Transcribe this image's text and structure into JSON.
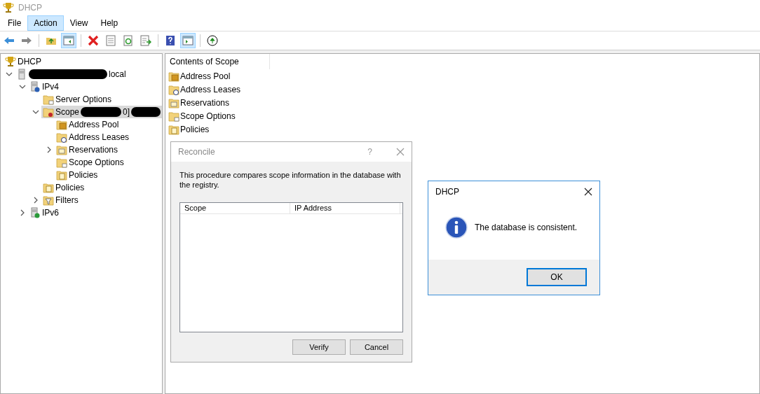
{
  "window": {
    "title": "DHCP"
  },
  "menu": [
    {
      "label": "File",
      "selected": false
    },
    {
      "label": "Action",
      "selected": true
    },
    {
      "label": "View",
      "selected": false
    },
    {
      "label": "Help",
      "selected": false
    }
  ],
  "toolbar": [
    {
      "kind": "back",
      "pressed": false
    },
    {
      "kind": "forward",
      "pressed": false
    },
    {
      "kind": "separator"
    },
    {
      "kind": "up-folder",
      "pressed": false
    },
    {
      "kind": "console-tree",
      "pressed": true
    },
    {
      "kind": "separator"
    },
    {
      "kind": "delete",
      "pressed": false
    },
    {
      "kind": "properties",
      "pressed": false
    },
    {
      "kind": "refresh",
      "pressed": false
    },
    {
      "kind": "export",
      "pressed": false
    },
    {
      "kind": "separator"
    },
    {
      "kind": "help",
      "pressed": false
    },
    {
      "kind": "action-pane",
      "pressed": true
    },
    {
      "kind": "separator"
    },
    {
      "kind": "start",
      "pressed": false
    }
  ],
  "tree": [
    {
      "kind": "dhcp",
      "selected": false,
      "parts": [
        {
          "kind": "text",
          "text": "DHCP"
        }
      ],
      "children": [
        {
          "kind": "server",
          "expanded": true,
          "selected": false,
          "parts": [
            {
              "kind": "redaction"
            },
            {
              "kind": "text",
              "text": "local"
            }
          ],
          "children": [
            {
              "kind": "ipv4",
              "expanded": true,
              "selected": false,
              "parts": [
                {
                  "kind": "text",
                  "text": "IPv4"
                }
              ],
              "children": [
                {
                  "kind": "options",
                  "selected": false,
                  "parts": [
                    {
                      "kind": "text",
                      "text": "Server Options"
                    }
                  ]
                },
                {
                  "kind": "scope",
                  "expanded": true,
                  "selected": true,
                  "parts": [
                    {
                      "kind": "text",
                      "text": "Scope"
                    },
                    {
                      "kind": "redaction"
                    },
                    {
                      "kind": "text",
                      "text": "0]"
                    },
                    {
                      "kind": "redaction"
                    }
                  ],
                  "children": [
                    {
                      "kind": "pool",
                      "selected": false,
                      "parts": [
                        {
                          "kind": "text",
                          "text": "Address Pool"
                        }
                      ]
                    },
                    {
                      "kind": "leases",
                      "selected": false,
                      "parts": [
                        {
                          "kind": "text",
                          "text": "Address Leases"
                        }
                      ]
                    },
                    {
                      "kind": "reservations",
                      "expanded": false,
                      "selected": false,
                      "parts": [
                        {
                          "kind": "text",
                          "text": "Reservations"
                        }
                      ]
                    },
                    {
                      "kind": "options",
                      "selected": false,
                      "parts": [
                        {
                          "kind": "text",
                          "text": "Scope Options"
                        }
                      ]
                    },
                    {
                      "kind": "policies",
                      "selected": false,
                      "parts": [
                        {
                          "kind": "text",
                          "text": "Policies"
                        }
                      ]
                    }
                  ]
                },
                {
                  "kind": "policies",
                  "selected": false,
                  "parts": [
                    {
                      "kind": "text",
                      "text": "Policies"
                    }
                  ]
                },
                {
                  "kind": "filters",
                  "expanded": false,
                  "selected": false,
                  "parts": [
                    {
                      "kind": "text",
                      "text": "Filters"
                    }
                  ]
                }
              ]
            },
            {
              "kind": "ipv6",
              "expanded": false,
              "selected": false,
              "parts": [
                {
                  "kind": "text",
                  "text": "IPv6"
                }
              ]
            }
          ]
        }
      ]
    }
  ],
  "content": {
    "header": "Contents of Scope",
    "items": [
      {
        "kind": "pool",
        "label": "Address Pool"
      },
      {
        "kind": "leases",
        "label": "Address Leases"
      },
      {
        "kind": "reservations",
        "label": "Reservations"
      },
      {
        "kind": "options",
        "label": "Scope Options"
      },
      {
        "kind": "policies",
        "label": "Policies"
      }
    ]
  },
  "reconcile": {
    "title": "Reconcile",
    "help": "?",
    "message": "This procedure compares scope information in the database with the registry.",
    "columns": [
      "Scope",
      "IP Address"
    ],
    "buttons": [
      "Verify",
      "Cancel"
    ]
  },
  "message_box": {
    "title": "DHCP",
    "message": "The database is consistent.",
    "button": "OK"
  }
}
